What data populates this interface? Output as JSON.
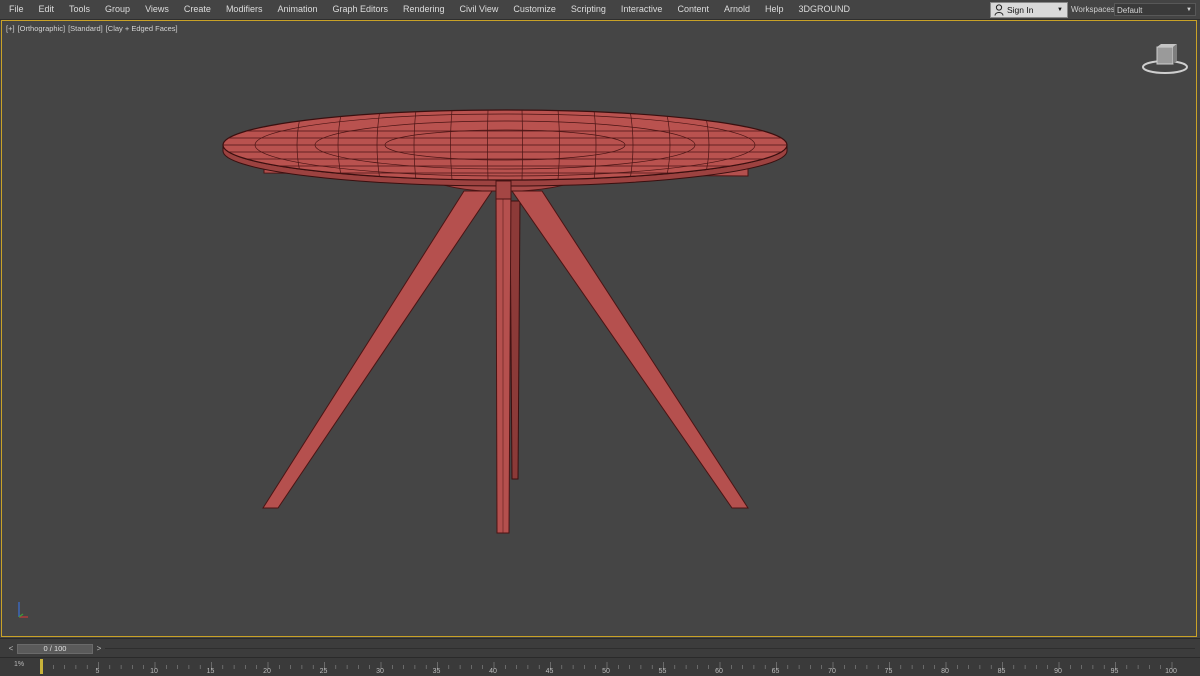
{
  "menubar": {
    "items": [
      "File",
      "Edit",
      "Tools",
      "Group",
      "Views",
      "Create",
      "Modifiers",
      "Animation",
      "Graph Editors",
      "Rendering",
      "Civil View",
      "Customize",
      "Scripting",
      "Interactive",
      "Content",
      "Arnold",
      "Help",
      "3DGROUND"
    ],
    "sign_in": "Sign In",
    "workspaces_label": "Workspaces:",
    "workspace_value": "Default"
  },
  "viewport": {
    "label_plus": "[+]",
    "label_view": "[Orthographic]",
    "label_shading_std": "[Standard]",
    "label_shading": "[Clay + Edged Faces]",
    "border_color": "#c9a227",
    "model_color": "#b5504e",
    "wire_color": "#4a1414"
  },
  "timeslider": {
    "prev": "<",
    "next": ">",
    "value": "0 / 100"
  },
  "trackbar": {
    "corner": "1%",
    "ticks": [
      "5",
      "10",
      "15",
      "20",
      "25",
      "30",
      "35",
      "40",
      "45",
      "50",
      "55",
      "60",
      "65",
      "70",
      "75",
      "80",
      "85",
      "90",
      "95",
      "100"
    ]
  }
}
